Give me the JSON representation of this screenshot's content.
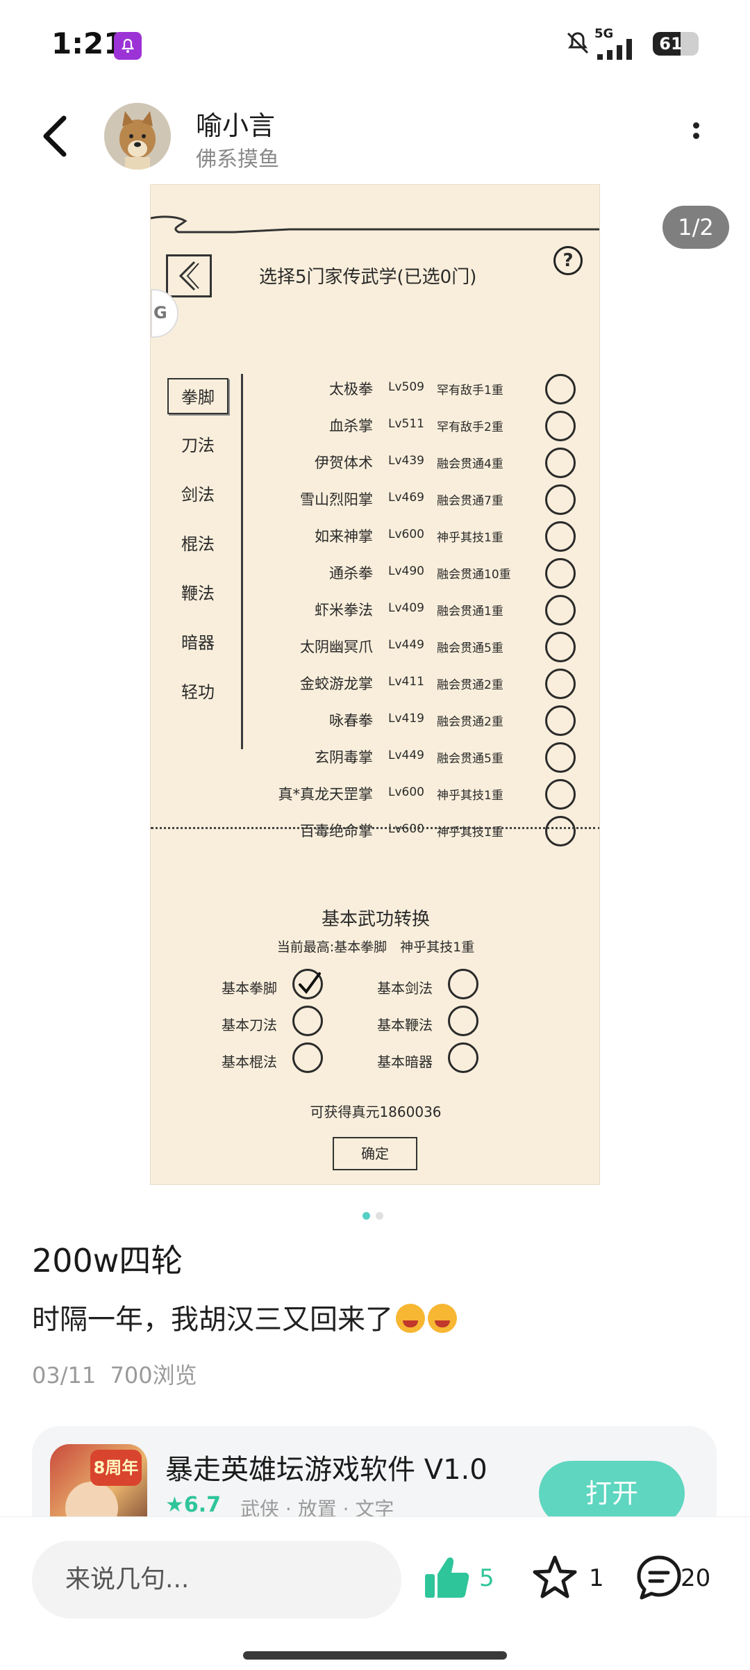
{
  "status_bar": {
    "time": "1:21",
    "network": "5G",
    "battery": "61",
    "battery_level": 0.61
  },
  "header": {
    "user_name": "喻小言",
    "user_subtitle": "佛系摸鱼"
  },
  "image_pager": {
    "indicator": "1/2",
    "current": 1,
    "total": 2
  },
  "game_screen": {
    "title": "选择5门家传武学(已选0门)",
    "help_label": "?",
    "side_tab_label": "G",
    "categories": [
      "拳脚",
      "刀法",
      "剑法",
      "棍法",
      "鞭法",
      "暗器",
      "轻功"
    ],
    "selected_category": "拳脚",
    "skills": [
      {
        "name": "太极拳",
        "level": "Lv509",
        "rank": "罕有敌手1重"
      },
      {
        "name": "血杀掌",
        "level": "Lv511",
        "rank": "罕有敌手2重"
      },
      {
        "name": "伊贺体术",
        "level": "Lv439",
        "rank": "融会贯通4重"
      },
      {
        "name": "雪山烈阳掌",
        "level": "Lv469",
        "rank": "融会贯通7重"
      },
      {
        "name": "如来神掌",
        "level": "Lv600",
        "rank": "神乎其技1重"
      },
      {
        "name": "通杀拳",
        "level": "Lv490",
        "rank": "融会贯通10重"
      },
      {
        "name": "虾米拳法",
        "level": "Lv409",
        "rank": "融会贯通1重"
      },
      {
        "name": "太阴幽冥爪",
        "level": "Lv449",
        "rank": "融会贯通5重"
      },
      {
        "name": "金蛟游龙掌",
        "level": "Lv411",
        "rank": "融会贯通2重"
      },
      {
        "name": "咏春拳",
        "level": "Lv419",
        "rank": "融会贯通2重"
      },
      {
        "name": "玄阴毒掌",
        "level": "Lv449",
        "rank": "融会贯通5重"
      },
      {
        "name": "真*真龙天罡掌",
        "level": "Lv600",
        "rank": "神乎其技1重"
      },
      {
        "name": "百毒绝命掌",
        "level": "Lv600",
        "rank": "神乎其技1重"
      }
    ],
    "conversion": {
      "title": "基本武功转换",
      "subtitle": "当前最高:基本拳脚　神乎其技1重",
      "options": [
        {
          "label": "基本拳脚",
          "checked": true
        },
        {
          "label": "基本剑法",
          "checked": false
        },
        {
          "label": "基本刀法",
          "checked": false
        },
        {
          "label": "基本鞭法",
          "checked": false
        },
        {
          "label": "基本棍法",
          "checked": false
        },
        {
          "label": "基本暗器",
          "checked": false
        }
      ],
      "gain_text": "可获得真元1860036",
      "confirm_label": "确定"
    }
  },
  "post": {
    "title": "200w四轮",
    "body": "时隔一年，我胡汉三又回来了",
    "date": "03/11",
    "views": "700浏览"
  },
  "app_card": {
    "name": "暴走英雄坛游戏软件 V1.0",
    "rating": "6.7",
    "tags": "武侠 · 放置 · 文字",
    "icon_badge": "8周年",
    "open_label": "打开"
  },
  "bottom_bar": {
    "comment_placeholder": "来说几句...",
    "likes": "5",
    "favorites": "1",
    "comments": "20"
  },
  "colors": {
    "accent": "#5fd6c0",
    "like": "#2fc59a",
    "game_bg": "#f8eedb",
    "notif_badge": "#9c33d6"
  }
}
